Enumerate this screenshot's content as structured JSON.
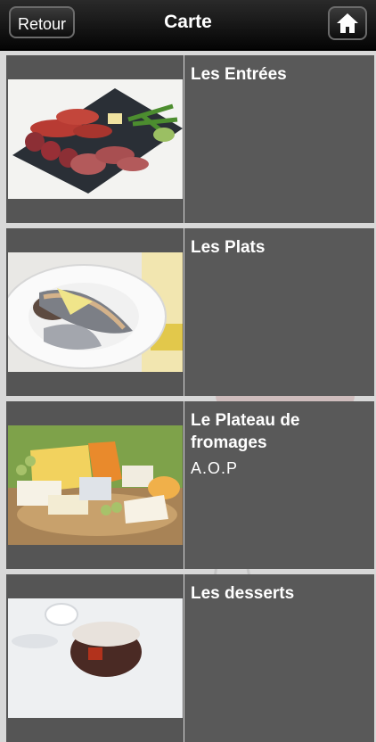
{
  "nav": {
    "back_label": "Retour",
    "title": "Carte",
    "home_icon": "home-icon"
  },
  "menu": [
    {
      "label": "Les Entrées",
      "sub": ""
    },
    {
      "label": "Les Plats",
      "sub": ""
    },
    {
      "label": "Le Plateau de fromages",
      "sub": "A.O.P"
    },
    {
      "label": "Les desserts",
      "sub": ""
    }
  ],
  "colors": {
    "background": "#d8d8d8",
    "panel": "#595959",
    "topbar": "#111111"
  }
}
